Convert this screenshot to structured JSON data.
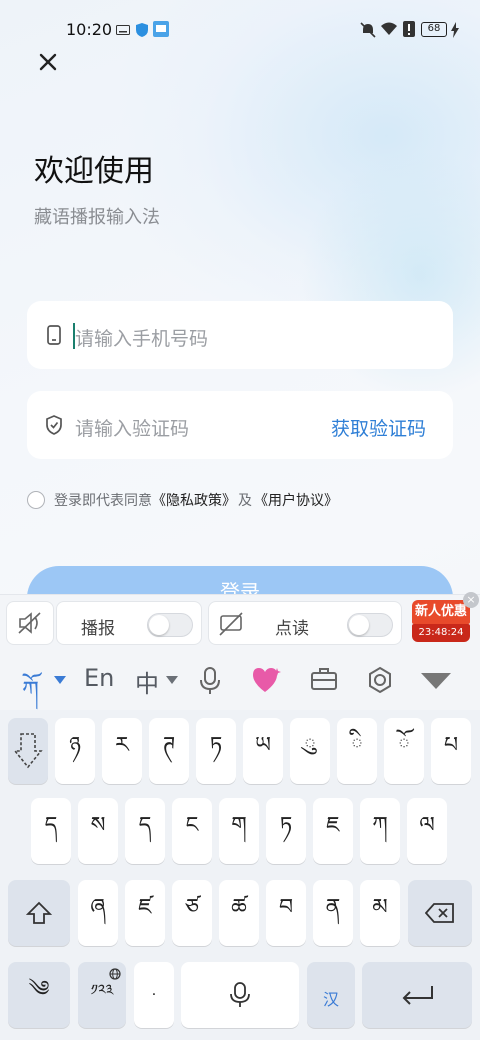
{
  "status_bar": {
    "time": "10:20",
    "battery": "68"
  },
  "login": {
    "title": "欢迎使用",
    "subtitle": "藏语播报输入法",
    "phone_placeholder": "请输入手机号码",
    "code_placeholder": "请输入验证码",
    "get_code": "获取验证码",
    "agree_prefix": "登录即代表同意",
    "privacy": "《隐私政策》",
    "and": "及",
    "user_agreement": "《用户协议》",
    "login_button": "登录"
  },
  "keyboard": {
    "toolbar": {
      "broadcast": "播报",
      "read": "点读"
    },
    "promo": {
      "title": "新人优惠",
      "countdown": "23:48:24"
    },
    "bar": {
      "tibetan": "ཀོ",
      "english": "En",
      "chinese": "中"
    },
    "row1": [
      "ཉ",
      "ར",
      "ཊ",
      "ཏ",
      "ཡ",
      "ུ",
      "ི",
      "ོ",
      "པ"
    ],
    "row2": [
      "ད",
      "ས",
      "ད",
      "ང",
      "ག",
      "ཏ",
      "ཇ",
      "ཀ",
      "ལ"
    ],
    "row3": [
      "ཞ",
      "ཛ",
      "ཙ",
      "ཚ",
      "བ",
      "ན",
      "མ"
    ],
    "bottom": {
      "symbol": "༄",
      "numbers": "༡༢༣",
      "dot": "·",
      "translate": "汉"
    },
    "accent_color": "#3a7bd5"
  }
}
